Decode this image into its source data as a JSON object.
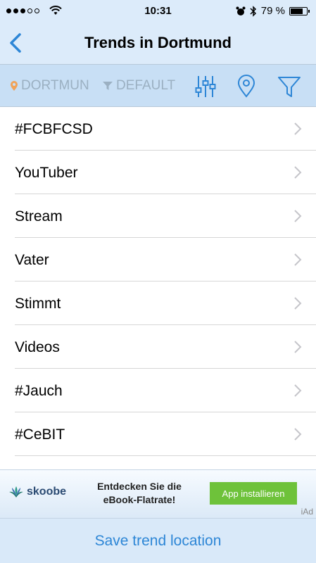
{
  "status_bar": {
    "time": "10:31",
    "battery": "79 %",
    "battery_level": 0.79
  },
  "nav": {
    "title": "Trends in Dortmund"
  },
  "filter": {
    "location": "DORTMUN",
    "default": "DEFAULT"
  },
  "trends": [
    {
      "label": "#FCBFCSD"
    },
    {
      "label": "YouTuber"
    },
    {
      "label": "Stream"
    },
    {
      "label": "Vater"
    },
    {
      "label": "Stimmt"
    },
    {
      "label": "Videos"
    },
    {
      "label": "#Jauch"
    },
    {
      "label": "#CeBIT"
    }
  ],
  "ad": {
    "brand": "skoobe",
    "text_line1": "Entdecken Sie die",
    "text_line2": "eBook-Flatrate!",
    "button": "App installieren",
    "iad": "iAd"
  },
  "footer": {
    "save_label": "Save trend location"
  },
  "colors": {
    "accent": "#2d86d6",
    "bar_bg": "#dcebfa",
    "filter_bg": "#c8dff5",
    "ad_button": "#6ec23a"
  }
}
